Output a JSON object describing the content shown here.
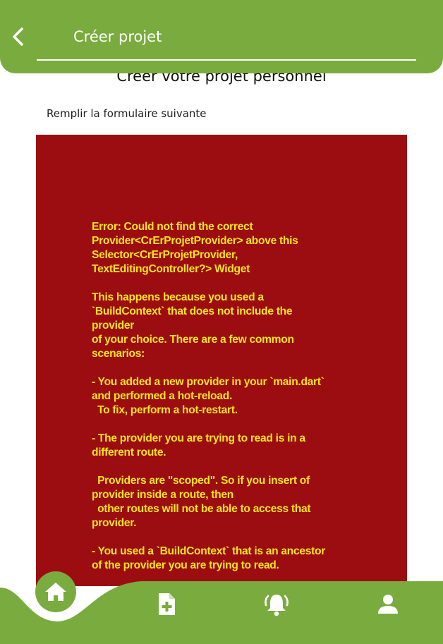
{
  "header": {
    "title": "Créer projet"
  },
  "main": {
    "heading": "Creer votre projet personnel",
    "subtitle": "Remplir la formulaire suivante",
    "error_message": "Error: Could not find the correct\nProvider<CrErProjetProvider> above this\nSelector<CrErProjetProvider,\nTextEditingController?> Widget\n\nThis happens because you used a\n`BuildContext` that does not include the\nprovider\nof your choice. There are a few common\nscenarios:\n\n- You added a new provider in your `main.dart`\nand performed a hot-reload.\n  To fix, perform a hot-restart.\n\n- The provider you are trying to read is in a\ndifferent route.\n\n  Providers are \"scoped\". So if you insert of\nprovider inside a route, then\n  other routes will not be able to access that\nprovider.\n\n- You used a `BuildContext` that is an ancestor\nof the provider you are trying to read."
  },
  "bottom_nav": {
    "items": [
      {
        "icon": "home-icon"
      },
      {
        "icon": "add-document-icon"
      },
      {
        "icon": "notification-bell-icon"
      },
      {
        "icon": "profile-icon"
      }
    ]
  },
  "colors": {
    "brand_green": "#7aab3e",
    "error_background": "#9c0d11",
    "error_text": "#f8e51c"
  }
}
